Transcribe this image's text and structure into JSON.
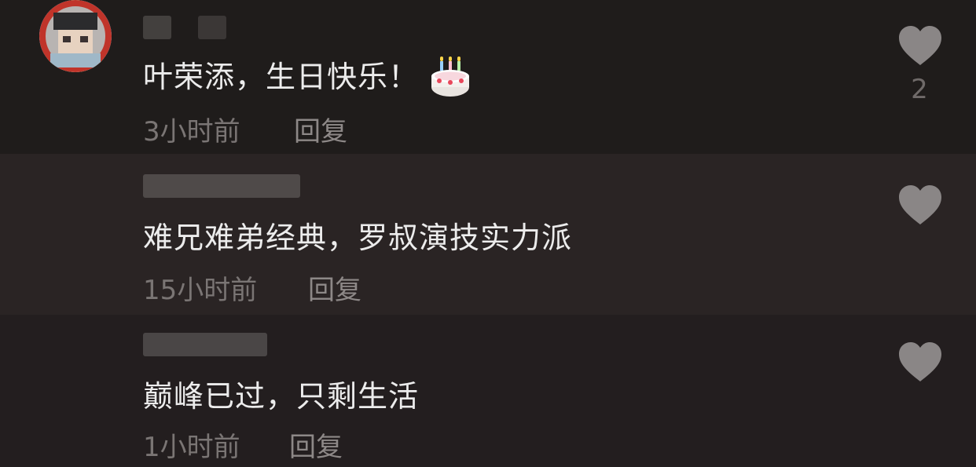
{
  "comments": [
    {
      "text": "叶荣添，生日快乐！",
      "emoji": "birthday-cake",
      "time": "3小时前",
      "reply": "回复",
      "likes": "2"
    },
    {
      "text": "难兄难弟经典，罗叔演技实力派",
      "time": "15小时前",
      "reply": "回复"
    },
    {
      "text": "巅峰已过，只剩生活",
      "time": "1小时前",
      "reply": "回复"
    }
  ],
  "colors": {
    "comment_text": "#ececec",
    "meta_text": "#7a7574",
    "heart": "#8a8686"
  }
}
